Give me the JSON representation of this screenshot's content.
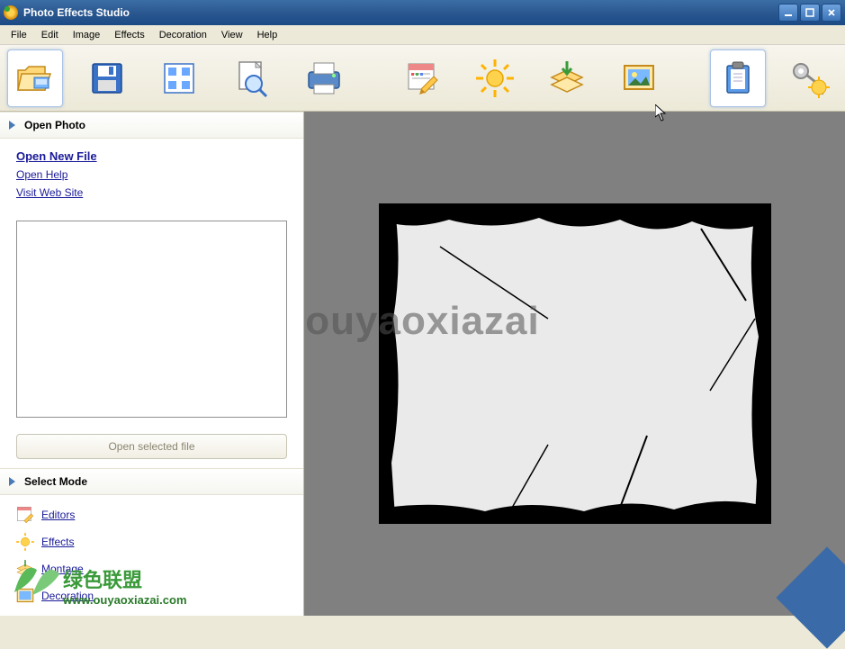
{
  "title": "Photo Effects Studio",
  "menu": {
    "file": "File",
    "edit": "Edit",
    "image": "Image",
    "effects": "Effects",
    "decoration": "Decoration",
    "view": "View",
    "help": "Help"
  },
  "toolbar_icons": [
    "folder-open-icon",
    "save-disk-icon",
    "grid-view-icon",
    "zoom-page-icon",
    "print-icon",
    "calendar-edit-icon",
    "sun-effects-icon",
    "layers-montage-icon",
    "picture-decoration-icon",
    "clipboard-icon",
    "key-register-icon"
  ],
  "sidebar": {
    "open_photo": {
      "header": "Open Photo",
      "links": {
        "open_new": "Open New File",
        "open_help": "Open Help",
        "visit_site": "Visit Web Site"
      },
      "open_selected_btn": "Open selected file"
    },
    "select_mode": {
      "header": "Select Mode",
      "items": {
        "editors": "Editors",
        "effects": "Effects",
        "montage": "Montage",
        "decoration": "Decoration"
      }
    }
  },
  "watermarks": {
    "main": "ouyaoxiazai",
    "overlay_text": "绿色联盟",
    "overlay_url": "www.ouyaoxiazai.com"
  }
}
